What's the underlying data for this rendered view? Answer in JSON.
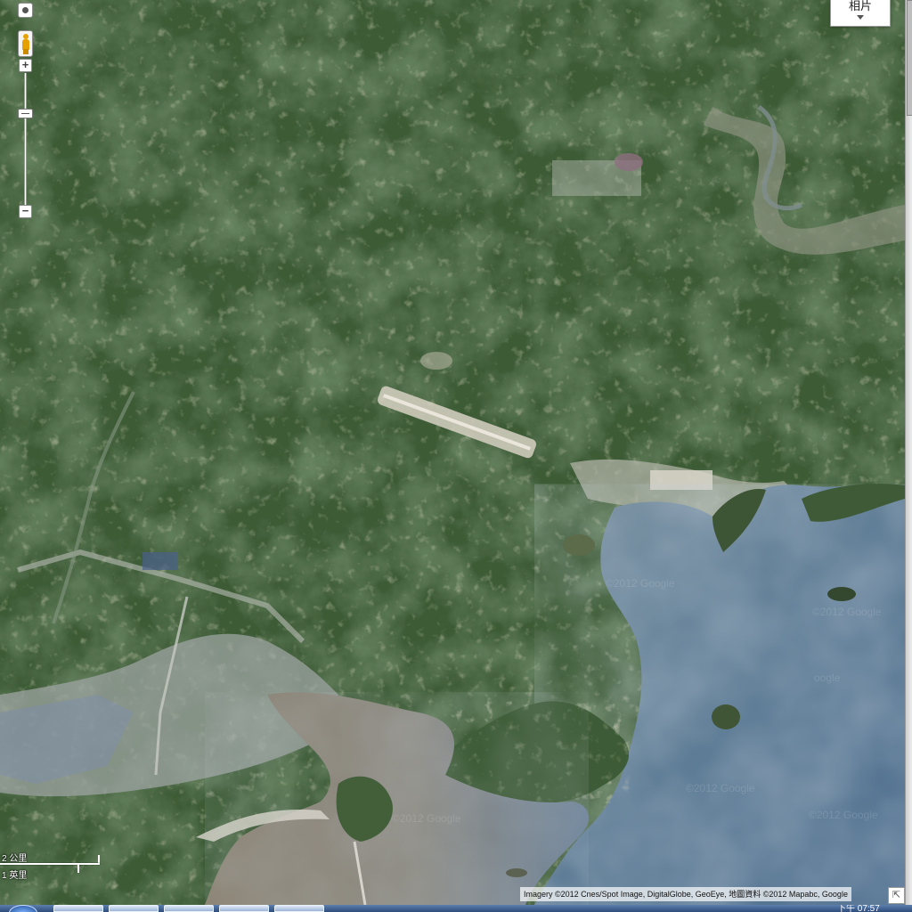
{
  "map": {
    "mode": "satellite",
    "photos_label": "相片",
    "scale": {
      "metric_label": "2 公里",
      "imperial_label": "1 英里"
    },
    "attribution": "Imagery ©2012 Cnes/Spot Image, DigitalGlobe, GeoEye, 地圖資料 ©2012 Mapabc, Google",
    "watermarks": [
      "©2012 Google",
      "©2012 Google",
      "oogle",
      "©2012 Google",
      "©2012 Google",
      "©2012 Google"
    ],
    "icons": {
      "pan": "pan-control-icon",
      "pegman": "pegman-icon",
      "zoom_in": "zoom-in-icon",
      "zoom_out": "zoom-out-icon",
      "expand": "expand-corner-icon"
    },
    "zoom_level_fraction": 0.3
  },
  "taskbar": {
    "clock": "下午 07:57"
  },
  "colors": {
    "forest": "#3c5a34",
    "sea": "#5d7990",
    "sediment": "#8a8375",
    "urban": "#a7acab"
  }
}
